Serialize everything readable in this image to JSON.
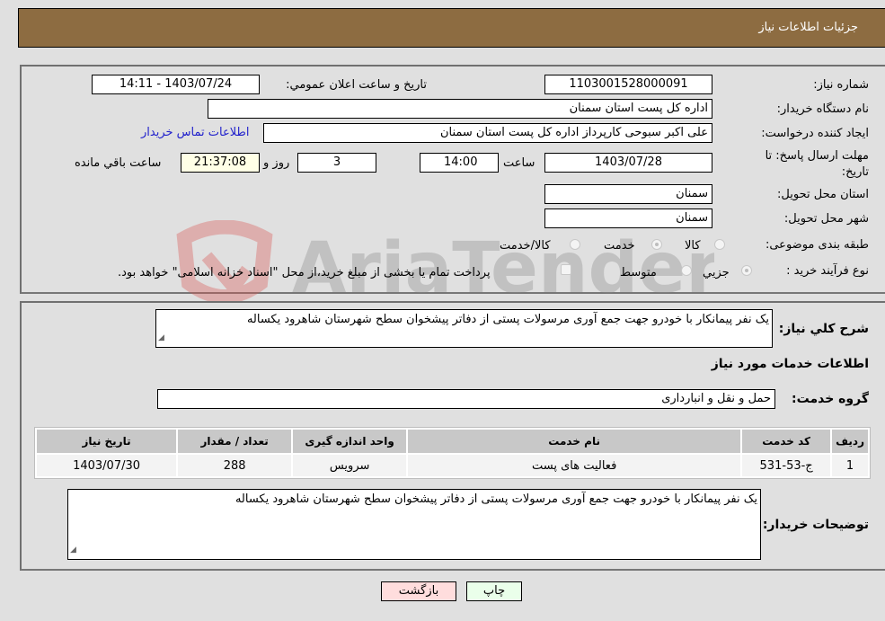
{
  "header": {
    "title": "جزئیات اطلاعات نیاز"
  },
  "form": {
    "need_number": {
      "label": "شماره نیاز:",
      "value": "1103001528000091"
    },
    "announce_datetime": {
      "label": "تاریخ و ساعت اعلان عمومي:",
      "value": "1403/07/24 - 14:11"
    },
    "buyer_org": {
      "label": "نام دستگاه خریدار:",
      "value": "اداره کل پست استان سمنان"
    },
    "requester": {
      "label": "ایجاد کننده درخواست:",
      "value": "علی اکبر سبوحی کارپرداز اداره کل پست استان سمنان"
    },
    "contact_link": "اطلاعات تماس خریدار",
    "deadline": {
      "label": "مهلت ارسال پاسخ: تا تاریخ:",
      "date": "1403/07/28",
      "time_label": "ساعت",
      "time": "14:00",
      "days": "3",
      "days_label": "روز و",
      "remaining": "21:37:08",
      "remaining_label": "ساعت باقي مانده"
    },
    "province": {
      "label": "استان محل تحویل:",
      "value": "سمنان"
    },
    "city": {
      "label": "شهر محل تحویل:",
      "value": "سمنان"
    },
    "category": {
      "label": "طبقه بندی موضوعی:",
      "options": [
        "کالا",
        "خدمت",
        "کالا/خدمت"
      ],
      "selected": "خدمت"
    },
    "process_type": {
      "label": "نوع فرآیند خرید :",
      "options": [
        "جزيي",
        "متوسط"
      ],
      "selected": "جزيي",
      "treasury_checkbox_label": "پرداخت تمام یا بخشی از مبلغ خرید،از محل \"اسناد خزانه اسلامی\" خواهد بود.",
      "treasury_checked": false
    }
  },
  "details": {
    "summary_label": "شرح کلي نياز:",
    "summary_text": "یک نفر پیمانکار با خودرو جهت جمع آوری مرسولات پستی از دفاتر پیشخوان سطح شهرستان شاهرود یکساله",
    "services_heading": "اطلاعات خدمات مورد نياز",
    "service_group_label": "گروه خدمت:",
    "service_group_value": "حمل و نقل و انبارداری",
    "table": {
      "headers": [
        "رديف",
        "کد خدمت",
        "نام خدمت",
        "واحد اندازه گیری",
        "تعداد / مقدار",
        "تاریخ نیاز"
      ],
      "rows": [
        [
          "1",
          "ج-53-531",
          "فعالیت های پست",
          "سرویس",
          "288",
          "1403/07/30"
        ]
      ]
    },
    "buyer_notes_label": "توضيحات خريدار:",
    "buyer_notes_text": "یک نفر پیمانکار با خودرو جهت جمع آوری مرسولات پستی از دفاتر پیشخوان سطح شهرستان شاهرود یکساله"
  },
  "buttons": {
    "print": "چاپ",
    "back": "بازگشت"
  },
  "colors": {
    "header_bg": "#8d6c41",
    "print_bg": "#eaffea",
    "back_bg": "#ffdddd",
    "timer_bg": "#ffffe6",
    "link": "#2222cc"
  },
  "watermark": {
    "text": "AriaTender.neT"
  }
}
